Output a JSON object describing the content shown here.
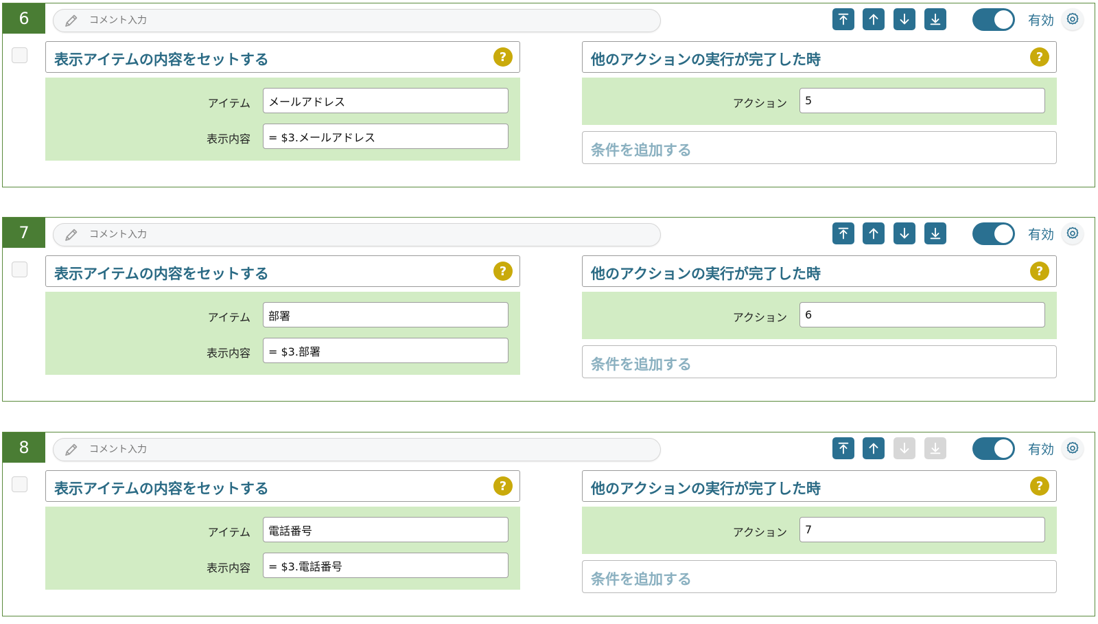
{
  "comment_placeholder": "コメント入力",
  "enabled_label": "有効",
  "colors": {
    "accent": "#2a7091",
    "badge": "#4a7d34",
    "help": "#c9aa0b",
    "panel_green": "#d2ecc4",
    "disabled": "#d7d7d7"
  },
  "icons": [
    "pencil-icon",
    "move-top-icon",
    "move-up-icon",
    "move-down-icon",
    "move-bottom-icon",
    "gear-icon",
    "help-icon"
  ],
  "rules": [
    {
      "number": "6",
      "down_enabled": true,
      "action": {
        "title": "表示アイテムの内容をセットする",
        "item_label": "アイテム",
        "item_value": "メールアドレス",
        "content_label": "表示内容",
        "content_value": "= $3.メールアドレス"
      },
      "trigger": {
        "title": "他のアクションの実行が完了した時",
        "action_label": "アクション",
        "action_value": "5",
        "add_condition": "条件を追加する"
      }
    },
    {
      "number": "7",
      "down_enabled": true,
      "action": {
        "title": "表示アイテムの内容をセットする",
        "item_label": "アイテム",
        "item_value": "部署",
        "content_label": "表示内容",
        "content_value": "= $3.部署"
      },
      "trigger": {
        "title": "他のアクションの実行が完了した時",
        "action_label": "アクション",
        "action_value": "6",
        "add_condition": "条件を追加する"
      }
    },
    {
      "number": "8",
      "down_enabled": false,
      "action": {
        "title": "表示アイテムの内容をセットする",
        "item_label": "アイテム",
        "item_value": "電話番号",
        "content_label": "表示内容",
        "content_value": "= $3.電話番号"
      },
      "trigger": {
        "title": "他のアクションの実行が完了した時",
        "action_label": "アクション",
        "action_value": "7",
        "add_condition": "条件を追加する"
      }
    }
  ]
}
